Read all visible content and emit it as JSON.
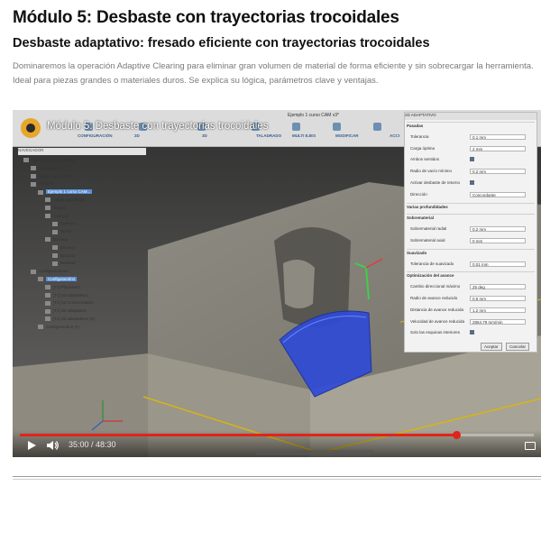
{
  "page": {
    "title": "Módulo 5: Desbaste con trayectorias trocoidales",
    "subtitle": "Desbaste adaptativo: fresado eficiente con trayectorias trocoidales",
    "description": "Dominaremos la operación Adaptive Clearing para eliminar gran volumen de material de forma eficiente y sin sobrecargar la herramienta. Ideal para piezas grandes o materiales duros. Se explica su lógica, parámetros clave y ventajas."
  },
  "video": {
    "overlay_title": "Módulo 5: Desbaste con trayectorias trocoidales",
    "current_time": "35:00",
    "duration": "48:30",
    "time_display": "35:00 / 48:30",
    "progress": 0.85,
    "icons": [
      "play-icon",
      "volume-icon",
      "fullscreen-icon",
      "channel-logo"
    ],
    "colors": {
      "progress": "#e2231a",
      "toolpath": "#2e4bd6",
      "stock": "#9a9689"
    }
  },
  "app": {
    "window_title": "Ejemplo 1 curso CAM v3*",
    "toolbar_groups": [
      "CONFIGURACIÓN",
      "2D",
      "3D",
      "TALADRADO",
      "MULTI EJES",
      "MODIFICAR",
      "ACCI"
    ],
    "browser": {
      "header": "NAVEGADOR",
      "nodes": [
        {
          "label": "Ejemplo 1 curso CAM v3",
          "indent": 0,
          "selected": false
        },
        {
          "label": "Unidades: mm",
          "indent": 1,
          "selected": false
        },
        {
          "label": "Vistas con nombre",
          "indent": 1,
          "selected": false
        },
        {
          "label": "Modelos",
          "indent": 1,
          "selected": false
        },
        {
          "label": "Ejemplo 1 curso CAM...",
          "indent": 2,
          "selected": true
        },
        {
          "label": "Vistas guardadas",
          "indent": 3,
          "selected": false
        },
        {
          "label": "Origen",
          "indent": 3,
          "selected": false
        },
        {
          "label": "Cuerpos",
          "indent": 3,
          "selected": false
        },
        {
          "label": "Cuerpo1",
          "indent": 4,
          "selected": false
        },
        {
          "label": "Techo",
          "indent": 4,
          "selected": false
        },
        {
          "label": "Bocetos",
          "indent": 3,
          "selected": false
        },
        {
          "label": "Boceto1",
          "indent": 4,
          "selected": false
        },
        {
          "label": "Boceto2",
          "indent": 4,
          "selected": false
        },
        {
          "label": "Boceto4",
          "indent": 4,
          "selected": false
        },
        {
          "label": "Configuraciones",
          "indent": 1,
          "selected": false
        },
        {
          "label": "Configuración1",
          "indent": 2,
          "selected": true
        },
        {
          "label": "[T1] Planeado1",
          "indent": 3,
          "selected": false
        },
        {
          "label": "[T1] 2D adaptativo1",
          "indent": 3,
          "selected": false
        },
        {
          "label": "[T1] 2D Contorneado1",
          "indent": 3,
          "selected": false
        },
        {
          "label": "[T1] 2D adaptativo",
          "indent": 3,
          "selected": false
        },
        {
          "label": "[T4] 2D adaptativo4 (2)",
          "indent": 3,
          "selected": false
        },
        {
          "label": "Configuración2 (2)",
          "indent": 2,
          "selected": false
        }
      ]
    },
    "panel": {
      "title": "2D ADAPTATIVO",
      "rows": [
        {
          "label": "Pasadas",
          "value": "",
          "kind": "section"
        },
        {
          "label": "Tolerancia",
          "value": "0.1 mm",
          "kind": "field"
        },
        {
          "label": "Carga óptima",
          "value": "2 mm",
          "kind": "field"
        },
        {
          "label": "Ambos sentidos",
          "value": "",
          "kind": "check"
        },
        {
          "label": "Radio de vacío mínimo",
          "value": "0.2 mm",
          "kind": "field"
        },
        {
          "label": "Activar desbaste de retorno",
          "value": "",
          "kind": "check"
        },
        {
          "label": "Dirección",
          "value": "Concordante",
          "kind": "field"
        },
        {
          "label": "Varias profundidades",
          "value": "",
          "kind": "section"
        },
        {
          "label": "Sobrematerial",
          "value": "",
          "kind": "section"
        },
        {
          "label": "Sobrematerial radial",
          "value": "0.2 mm",
          "kind": "field"
        },
        {
          "label": "Sobrematerial axial",
          "value": "0 mm",
          "kind": "field"
        },
        {
          "label": "Suavizado",
          "value": "",
          "kind": "section"
        },
        {
          "label": "Tolerancia de suavizado",
          "value": "0.01 mm",
          "kind": "field"
        },
        {
          "label": "Optimización del avance",
          "value": "",
          "kind": "section"
        },
        {
          "label": "Cambio direccional máximo",
          "value": "25 deg",
          "kind": "field"
        },
        {
          "label": "Radio de avance reducido",
          "value": "0.5 mm",
          "kind": "field"
        },
        {
          "label": "Distancia de avance reducida",
          "value": "1.2 mm",
          "kind": "field"
        },
        {
          "label": "Velocidad de avance reducida",
          "value": "2864.79 mm/min",
          "kind": "field"
        },
        {
          "label": "Solo las esquinas interiores",
          "value": "",
          "kind": "check"
        }
      ],
      "accept": "Aceptar",
      "cancel": "Cancelar"
    }
  }
}
